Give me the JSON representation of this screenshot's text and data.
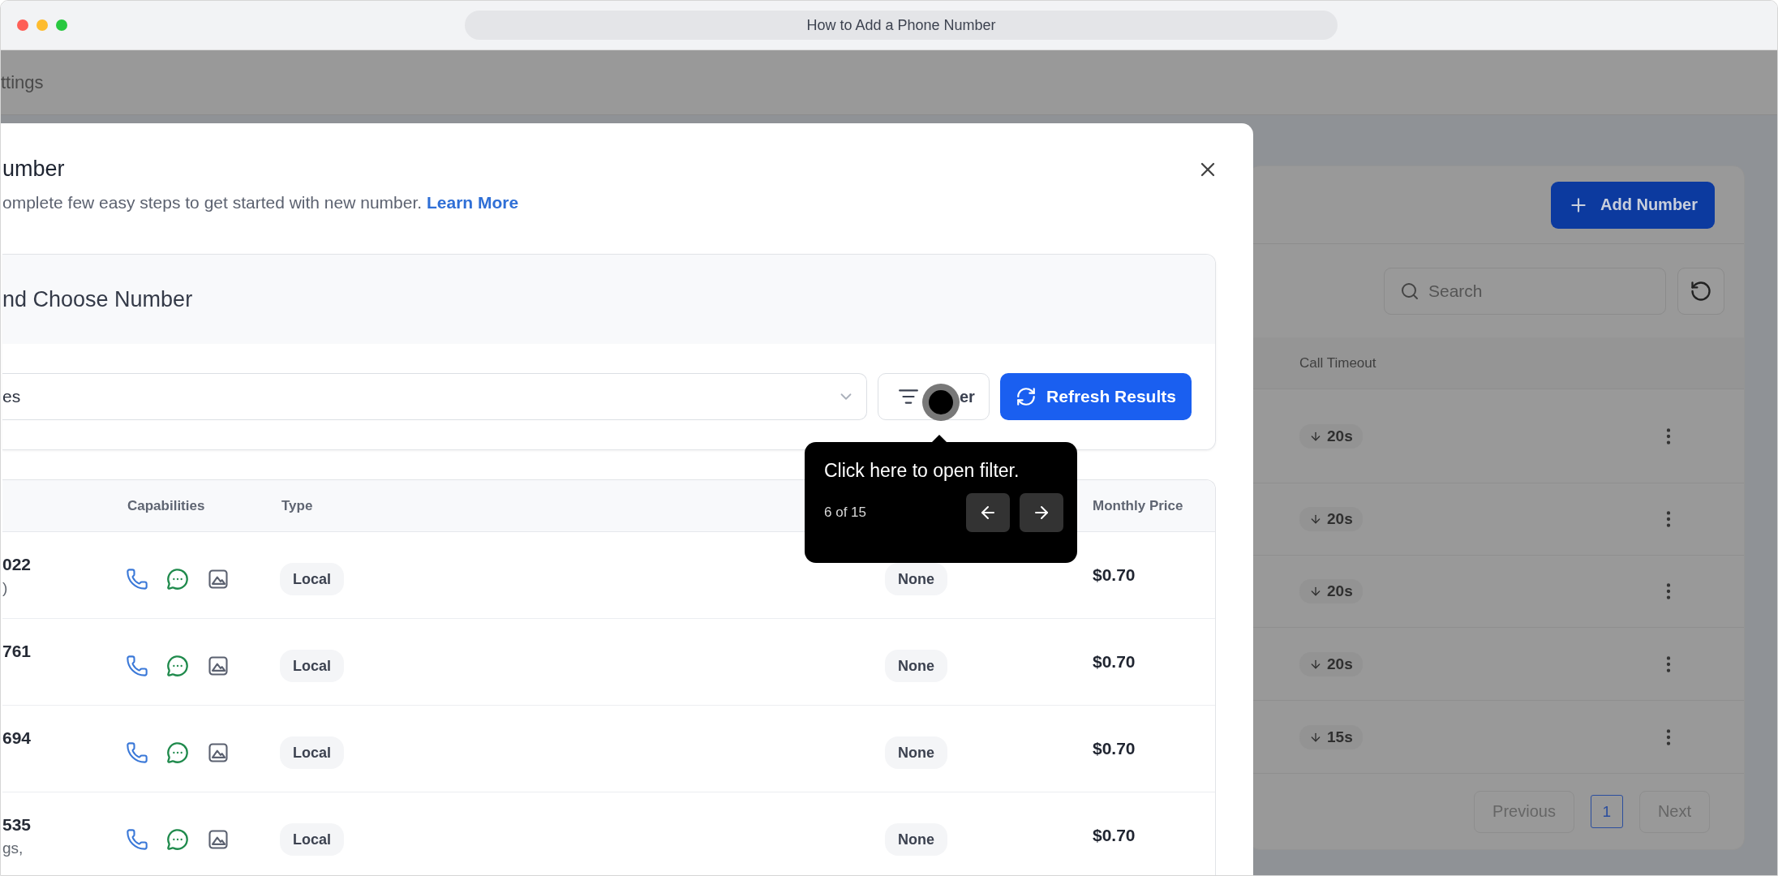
{
  "browser": {
    "title": "How to Add a Phone Number"
  },
  "background": {
    "nav_item": "ttings",
    "add_button": "Add Number",
    "search": {
      "placeholder": "Search"
    },
    "table": {
      "column": "Call Timeout",
      "rows": [
        {
          "timeout": "20s"
        },
        {
          "timeout": "20s"
        },
        {
          "timeout": "20s"
        },
        {
          "timeout": "20s"
        },
        {
          "timeout": "15s"
        }
      ]
    },
    "pagination": {
      "previous": "Previous",
      "pages": [
        {
          "label": "1",
          "selected": true
        }
      ],
      "next": "Next"
    }
  },
  "modal": {
    "title": "umber",
    "subtitle": "omplete few easy steps to get started with new number.",
    "link": "Learn More",
    "section": {
      "title": "nd Choose Number",
      "select_value": "es",
      "filter_button": "er",
      "refresh_button": "Refresh Results"
    },
    "table": {
      "columns": [
        "Capabilities",
        "Type",
        "Monthly Price"
      ],
      "rows": [
        {
          "number": "022",
          "secondary": ")",
          "type": "Local",
          "extra": "None",
          "price": "$0.70"
        },
        {
          "number": "761",
          "type": "Local",
          "extra": "None",
          "price": "$0.70"
        },
        {
          "number": "694",
          "type": "Local",
          "extra": "None",
          "price": "$0.70"
        },
        {
          "number": "535",
          "secondary": "gs,",
          "type": "Local",
          "extra": "None",
          "price": "$0.70"
        }
      ]
    }
  },
  "tooltip": {
    "text": "Click here to open filter.",
    "step": "6 of 15"
  }
}
